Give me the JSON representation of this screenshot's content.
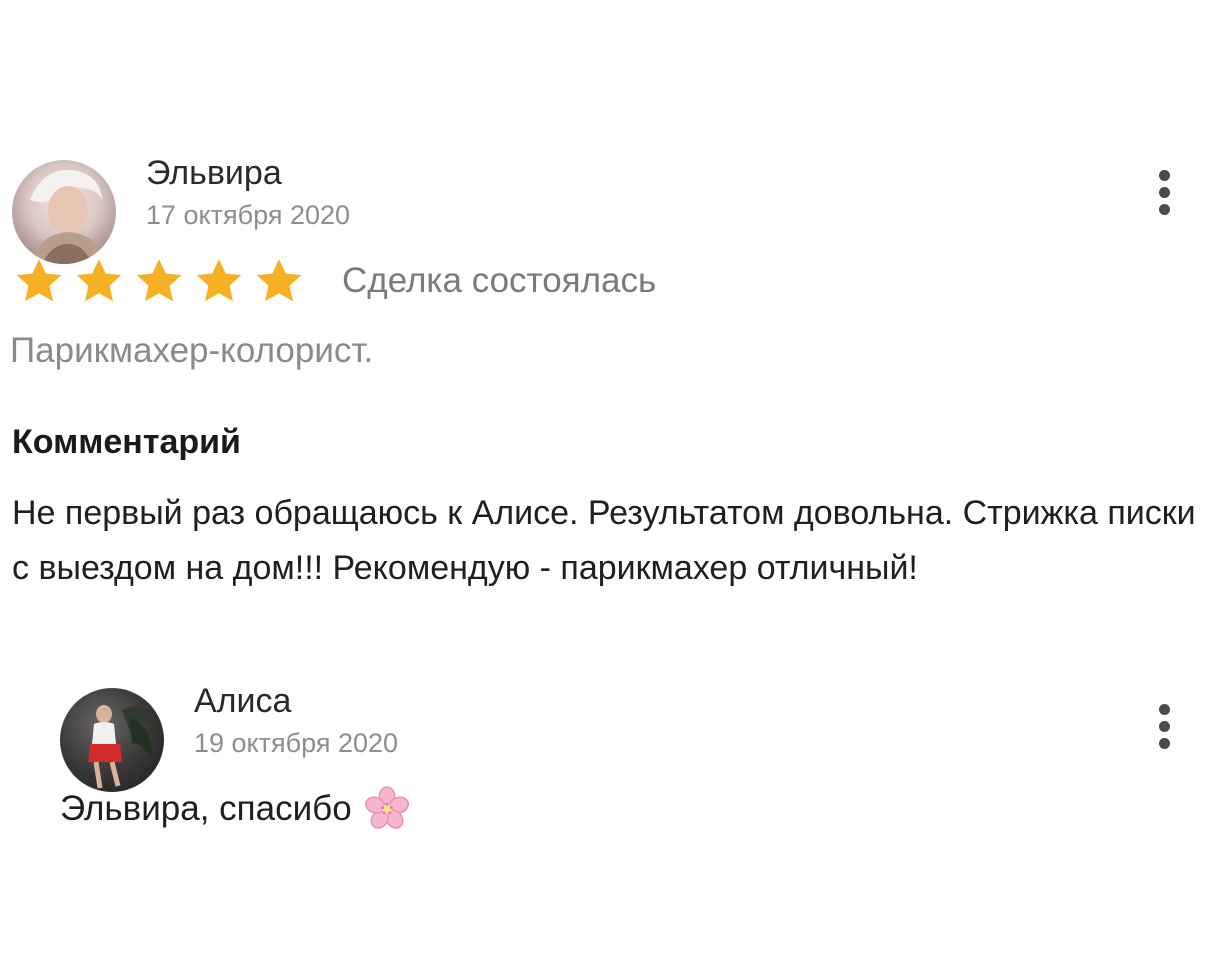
{
  "review": {
    "author": "Эльвира",
    "date": "17 октября 2020",
    "rating": 5,
    "rating_max": 5,
    "star_color": "#F5B123",
    "deal_status": "Сделка состоялась",
    "specialty": "Парикмахер-колорист.",
    "comment_heading": "Комментарий",
    "comment_text": "Не первый раз обращаюсь к Алисе. Результатом довольна. Стрижка писки с выездом на дом!!! Рекомендую - парикмахер отличный!"
  },
  "reply": {
    "author": "Алиса",
    "date": "19 октября 2020",
    "text": "Эльвира, спасибо",
    "emoji_icon": "cherry-blossom-icon"
  },
  "icons": {
    "menu": "more-vertical-icon"
  }
}
